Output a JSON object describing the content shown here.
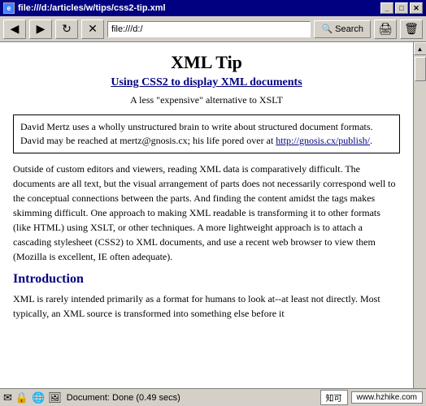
{
  "titlebar": {
    "icon": "🌐",
    "text": "file:///d:/articles/w/tips/css2-tip.xml",
    "minimize": "_",
    "maximize": "□",
    "close": "✕"
  },
  "toolbar": {
    "back_label": "◀",
    "forward_label": "▶",
    "reload_label": "↻",
    "stop_label": "✕",
    "address_value": "file:///d:/",
    "search_label": "Search",
    "print_label": "🖨",
    "trash_label": "🗑"
  },
  "page": {
    "title": "XML Tip",
    "subtitle": "Using CSS2 to display XML documents",
    "byline": "A less \"expensive\" alternative to XSLT",
    "author_text": "David Mertz uses a wholly unstructured brain to write about structured document formats. David may be reached at mertz@gnosis.cx; his life pored over at ",
    "author_link_text": "http://gnosis.cx/publish/",
    "author_link_href": "http://gnosis.cx/publish/",
    "author_end": ".",
    "body_paragraph": "Outside of custom editors and viewers, reading XML data is comparatively difficult. The documents are all text, but the visual arrangement of parts does not necessarily correspond well to the conceptual connections between the parts. And finding the content amidst the tags makes skimming difficult. One approach to making XML readable is transforming it to other formats (like HTML) using XSLT, or other techniques. A more lightweight approach is to attach a cascading stylesheet (CSS2) to XML documents, and use a recent web browser to view them (Mozilla is excellent, IE often adequate).",
    "section1_heading": "Introduction",
    "section1_text": "XML is rarely intended primarily as a format for humans to look at--at least not directly. Most typically, an XML source is transformed into something else before it"
  },
  "statusbar": {
    "text": "Document: Done (0.49 secs)",
    "badge_text": "知可",
    "badge2_text": "www.hzhike.com"
  }
}
